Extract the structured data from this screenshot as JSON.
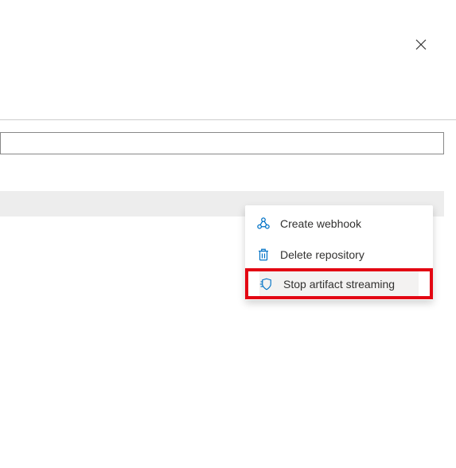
{
  "close": {
    "label": "Close"
  },
  "menu": {
    "items": [
      {
        "label": "Create webhook"
      },
      {
        "label": "Delete repository"
      },
      {
        "label": "Stop artifact streaming"
      }
    ]
  },
  "colors": {
    "highlight_border": "#e30613",
    "icon_blue": "#0072c6"
  }
}
